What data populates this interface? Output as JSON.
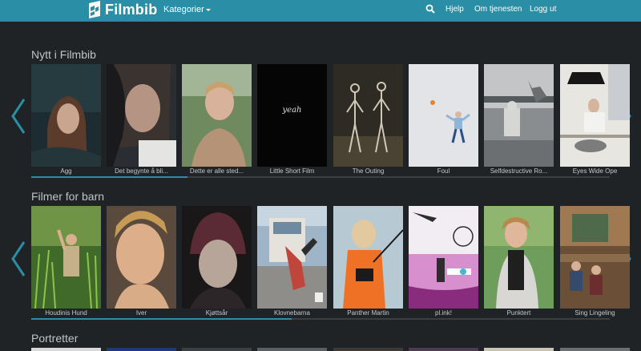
{
  "header": {
    "logo_text": "Filmbib",
    "categories_label": "Kategorier",
    "help_label": "Hjelp",
    "about_label": "Om tjenesten",
    "logout_label": "Logg ut",
    "colors": {
      "bar": "#2a8fa6",
      "background": "#202326"
    }
  },
  "sections": [
    {
      "title": "Nytt i Filmbib",
      "scroll_progress": 0.27,
      "films": [
        "Agg",
        "Det begynte å bli...",
        "Dette er alle sted...",
        "Little Short Film",
        "The Outing",
        "Foul",
        "Selfdestructive Ro...",
        "Eyes Wide Ope"
      ],
      "poster_text_little_short_film": "yeah"
    },
    {
      "title": "Filmer for barn",
      "scroll_progress": 0.45,
      "films": [
        "Houdinis Hund",
        "Iver",
        "Kjøttsår",
        "Klovnebarna",
        "Panther Martin",
        "pl.ink!",
        "Punktert",
        "Sing Lingeling"
      ]
    },
    {
      "title": "Portretter"
    }
  ]
}
